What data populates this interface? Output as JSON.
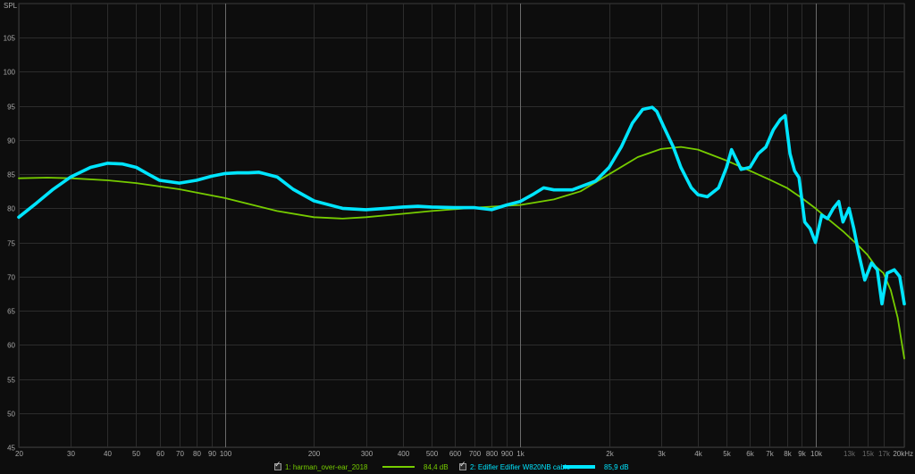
{
  "chart_data": {
    "type": "line",
    "ylabel": "SPL",
    "xscale": "log",
    "xlim": [
      20,
      20000
    ],
    "ylim": [
      45,
      110
    ],
    "grid": true,
    "y_ticks": [
      45,
      50,
      55,
      60,
      65,
      70,
      75,
      80,
      85,
      90,
      95,
      100,
      105
    ],
    "x_ticks": [
      {
        "v": 20,
        "label": "20"
      },
      {
        "v": 30,
        "label": "30"
      },
      {
        "v": 40,
        "label": "40"
      },
      {
        "v": 50,
        "label": "50"
      },
      {
        "v": 60,
        "label": "60"
      },
      {
        "v": 70,
        "label": "70"
      },
      {
        "v": 80,
        "label": "80"
      },
      {
        "v": 90,
        "label": "90"
      },
      {
        "v": 100,
        "label": "100"
      },
      {
        "v": 200,
        "label": "200"
      },
      {
        "v": 300,
        "label": "300"
      },
      {
        "v": 400,
        "label": "400"
      },
      {
        "v": 500,
        "label": "500"
      },
      {
        "v": 600,
        "label": "600"
      },
      {
        "v": 700,
        "label": "700"
      },
      {
        "v": 800,
        "label": "800"
      },
      {
        "v": 900,
        "label": "900"
      },
      {
        "v": 1000,
        "label": "1k"
      },
      {
        "v": 2000,
        "label": "2k"
      },
      {
        "v": 3000,
        "label": "3k"
      },
      {
        "v": 4000,
        "label": "4k"
      },
      {
        "v": 5000,
        "label": "5k"
      },
      {
        "v": 6000,
        "label": "6k"
      },
      {
        "v": 7000,
        "label": "7k"
      },
      {
        "v": 8000,
        "label": "8k"
      },
      {
        "v": 9000,
        "label": "9k"
      },
      {
        "v": 10000,
        "label": "10k"
      },
      {
        "v": 13000,
        "label": "13k",
        "dim": true
      },
      {
        "v": 15000,
        "label": "15k",
        "dim": true
      },
      {
        "v": 17000,
        "label": "17k",
        "dim": true
      },
      {
        "v": 20000,
        "label": "20kHz"
      }
    ],
    "major_gridlines": [
      100,
      1000,
      10000
    ],
    "series": [
      {
        "name": "1: harman_over-ear_2018",
        "level": "84,4 dB",
        "color": "#76cc00",
        "points": [
          [
            20,
            84.4
          ],
          [
            25,
            84.5
          ],
          [
            30,
            84.4
          ],
          [
            40,
            84.1
          ],
          [
            50,
            83.7
          ],
          [
            70,
            82.8
          ],
          [
            100,
            81.5
          ],
          [
            150,
            79.6
          ],
          [
            200,
            78.7
          ],
          [
            250,
            78.5
          ],
          [
            300,
            78.7
          ],
          [
            400,
            79.2
          ],
          [
            500,
            79.6
          ],
          [
            700,
            80.1
          ],
          [
            1000,
            80.5
          ],
          [
            1300,
            81.3
          ],
          [
            1600,
            82.5
          ],
          [
            2000,
            85.0
          ],
          [
            2500,
            87.5
          ],
          [
            3000,
            88.7
          ],
          [
            3500,
            89.0
          ],
          [
            4000,
            88.6
          ],
          [
            5000,
            87.0
          ],
          [
            6000,
            85.5
          ],
          [
            7000,
            84.2
          ],
          [
            8000,
            83.0
          ],
          [
            9000,
            81.5
          ],
          [
            10000,
            80.0
          ],
          [
            11000,
            78.5
          ],
          [
            12500,
            76.5
          ],
          [
            14000,
            74.5
          ],
          [
            15000,
            73.2
          ],
          [
            16000,
            71.5
          ],
          [
            17000,
            70.5
          ],
          [
            18000,
            68.0
          ],
          [
            19000,
            64.0
          ],
          [
            20000,
            58.0
          ]
        ]
      },
      {
        "name": "2: Edifier Edifier W820NB cable",
        "level": "85,9 dB",
        "color": "#00e5ff",
        "points": [
          [
            20,
            78.7
          ],
          [
            23,
            80.8
          ],
          [
            26,
            82.7
          ],
          [
            30,
            84.6
          ],
          [
            35,
            86.0
          ],
          [
            40,
            86.6
          ],
          [
            45,
            86.5
          ],
          [
            50,
            86.0
          ],
          [
            55,
            85.0
          ],
          [
            60,
            84.1
          ],
          [
            70,
            83.7
          ],
          [
            80,
            84.1
          ],
          [
            90,
            84.7
          ],
          [
            100,
            85.1
          ],
          [
            110,
            85.2
          ],
          [
            120,
            85.2
          ],
          [
            130,
            85.3
          ],
          [
            150,
            84.6
          ],
          [
            170,
            82.8
          ],
          [
            200,
            81.1
          ],
          [
            250,
            80.0
          ],
          [
            300,
            79.8
          ],
          [
            350,
            80.0
          ],
          [
            400,
            80.2
          ],
          [
            450,
            80.3
          ],
          [
            500,
            80.2
          ],
          [
            600,
            80.1
          ],
          [
            700,
            80.1
          ],
          [
            800,
            79.8
          ],
          [
            900,
            80.5
          ],
          [
            1000,
            81.0
          ],
          [
            1100,
            82.0
          ],
          [
            1200,
            83.0
          ],
          [
            1300,
            82.7
          ],
          [
            1500,
            82.7
          ],
          [
            1800,
            84.0
          ],
          [
            2000,
            86.0
          ],
          [
            2200,
            89.0
          ],
          [
            2400,
            92.5
          ],
          [
            2600,
            94.5
          ],
          [
            2800,
            94.8
          ],
          [
            2900,
            94.2
          ],
          [
            3100,
            91.5
          ],
          [
            3300,
            89.0
          ],
          [
            3500,
            86.0
          ],
          [
            3800,
            83.0
          ],
          [
            4000,
            82.0
          ],
          [
            4300,
            81.7
          ],
          [
            4700,
            83.0
          ],
          [
            5000,
            86.0
          ],
          [
            5200,
            88.6
          ],
          [
            5600,
            85.7
          ],
          [
            6000,
            86.0
          ],
          [
            6400,
            88.0
          ],
          [
            6800,
            89.0
          ],
          [
            7200,
            91.5
          ],
          [
            7600,
            93.0
          ],
          [
            7900,
            93.6
          ],
          [
            8200,
            88.0
          ],
          [
            8500,
            85.5
          ],
          [
            8800,
            84.5
          ],
          [
            9200,
            78.0
          ],
          [
            9600,
            77.0
          ],
          [
            10000,
            75.0
          ],
          [
            10500,
            79.0
          ],
          [
            11000,
            78.5
          ],
          [
            11500,
            80.0
          ],
          [
            12000,
            81.0
          ],
          [
            12400,
            78.0
          ],
          [
            13000,
            80.0
          ],
          [
            13500,
            77.0
          ],
          [
            14000,
            73.5
          ],
          [
            14700,
            69.5
          ],
          [
            15500,
            72.0
          ],
          [
            16200,
            71.0
          ],
          [
            16800,
            66.0
          ],
          [
            17500,
            70.5
          ],
          [
            18500,
            71.0
          ],
          [
            19300,
            70.0
          ],
          [
            20000,
            66.0
          ]
        ]
      }
    ]
  }
}
